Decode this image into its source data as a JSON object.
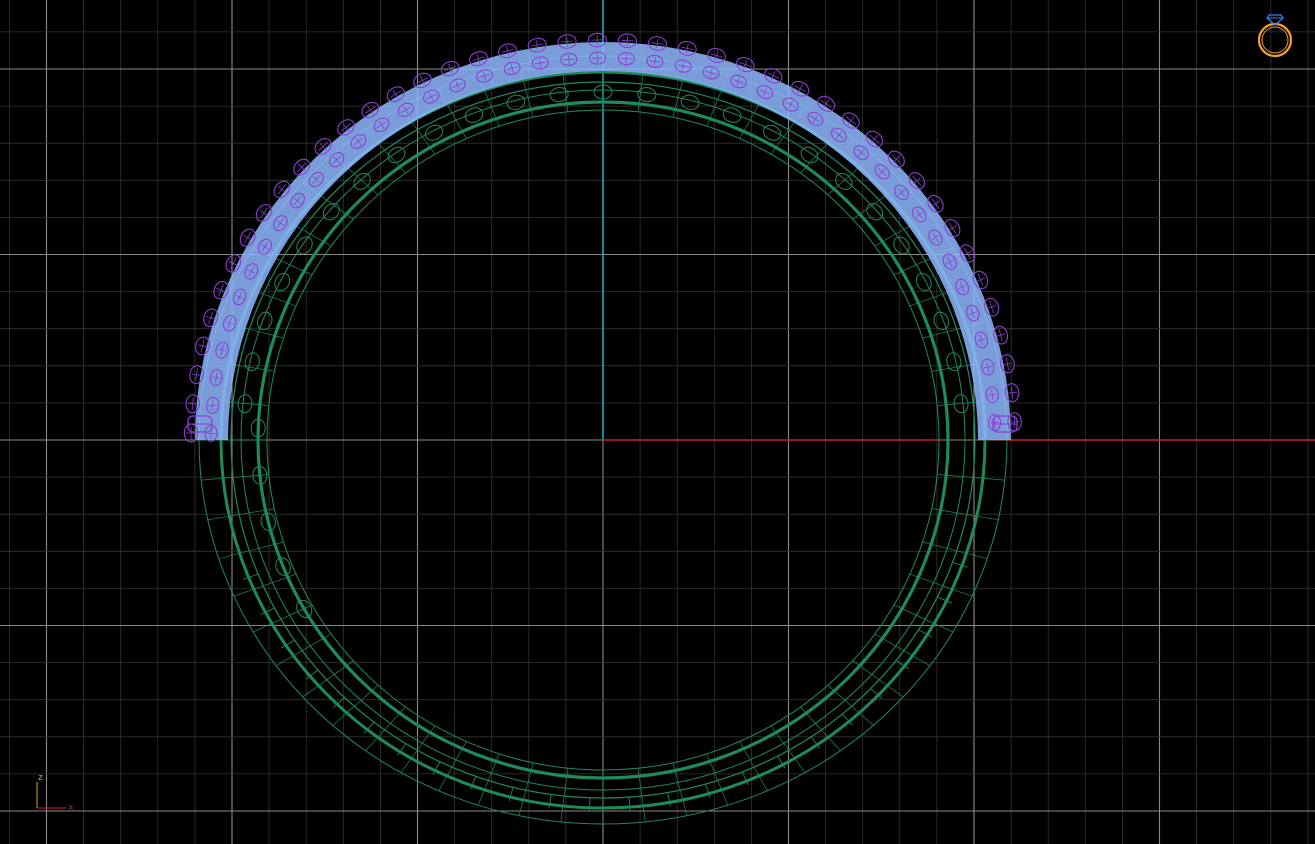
{
  "viewport": {
    "background": "#000000",
    "grid": {
      "minor_color": "#333333",
      "major_color": "#8a8a8a"
    },
    "axes": {
      "x_color": "#cc1f1f",
      "z_color": "#1aa8b8"
    }
  },
  "ring": {
    "band_color": "#1f8a5c",
    "stones_color": "#8a3fd0",
    "pave_fill_color": "#8fb8ff"
  },
  "axis_tripod": {
    "z_label": "z",
    "x_label": "x",
    "color": "#d8a040"
  },
  "view_cube": {
    "icon": "ring-icon",
    "ring_color": "#f0a030",
    "gem_color": "#3a7ee6"
  }
}
